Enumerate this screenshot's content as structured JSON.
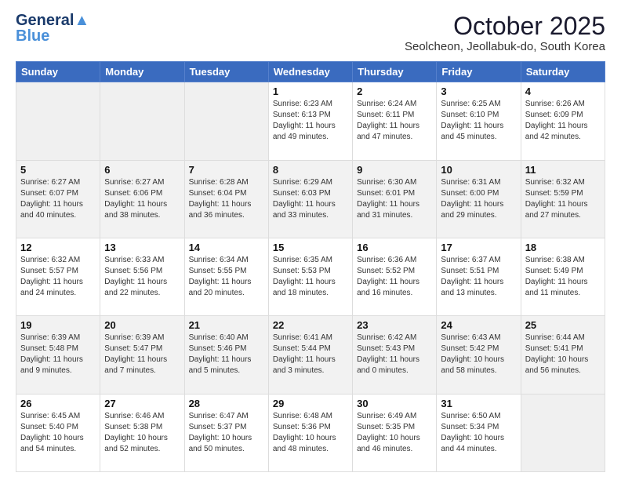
{
  "header": {
    "logo_line1": "General",
    "logo_line2": "Blue",
    "title": "October 2025",
    "subtitle": "Seolcheon, Jeollabuk-do, South Korea"
  },
  "weekdays": [
    "Sunday",
    "Monday",
    "Tuesday",
    "Wednesday",
    "Thursday",
    "Friday",
    "Saturday"
  ],
  "weeks": [
    [
      {
        "day": "",
        "info": ""
      },
      {
        "day": "",
        "info": ""
      },
      {
        "day": "",
        "info": ""
      },
      {
        "day": "1",
        "info": "Sunrise: 6:23 AM\nSunset: 6:13 PM\nDaylight: 11 hours\nand 49 minutes."
      },
      {
        "day": "2",
        "info": "Sunrise: 6:24 AM\nSunset: 6:11 PM\nDaylight: 11 hours\nand 47 minutes."
      },
      {
        "day": "3",
        "info": "Sunrise: 6:25 AM\nSunset: 6:10 PM\nDaylight: 11 hours\nand 45 minutes."
      },
      {
        "day": "4",
        "info": "Sunrise: 6:26 AM\nSunset: 6:09 PM\nDaylight: 11 hours\nand 42 minutes."
      }
    ],
    [
      {
        "day": "5",
        "info": "Sunrise: 6:27 AM\nSunset: 6:07 PM\nDaylight: 11 hours\nand 40 minutes."
      },
      {
        "day": "6",
        "info": "Sunrise: 6:27 AM\nSunset: 6:06 PM\nDaylight: 11 hours\nand 38 minutes."
      },
      {
        "day": "7",
        "info": "Sunrise: 6:28 AM\nSunset: 6:04 PM\nDaylight: 11 hours\nand 36 minutes."
      },
      {
        "day": "8",
        "info": "Sunrise: 6:29 AM\nSunset: 6:03 PM\nDaylight: 11 hours\nand 33 minutes."
      },
      {
        "day": "9",
        "info": "Sunrise: 6:30 AM\nSunset: 6:01 PM\nDaylight: 11 hours\nand 31 minutes."
      },
      {
        "day": "10",
        "info": "Sunrise: 6:31 AM\nSunset: 6:00 PM\nDaylight: 11 hours\nand 29 minutes."
      },
      {
        "day": "11",
        "info": "Sunrise: 6:32 AM\nSunset: 5:59 PM\nDaylight: 11 hours\nand 27 minutes."
      }
    ],
    [
      {
        "day": "12",
        "info": "Sunrise: 6:32 AM\nSunset: 5:57 PM\nDaylight: 11 hours\nand 24 minutes."
      },
      {
        "day": "13",
        "info": "Sunrise: 6:33 AM\nSunset: 5:56 PM\nDaylight: 11 hours\nand 22 minutes."
      },
      {
        "day": "14",
        "info": "Sunrise: 6:34 AM\nSunset: 5:55 PM\nDaylight: 11 hours\nand 20 minutes."
      },
      {
        "day": "15",
        "info": "Sunrise: 6:35 AM\nSunset: 5:53 PM\nDaylight: 11 hours\nand 18 minutes."
      },
      {
        "day": "16",
        "info": "Sunrise: 6:36 AM\nSunset: 5:52 PM\nDaylight: 11 hours\nand 16 minutes."
      },
      {
        "day": "17",
        "info": "Sunrise: 6:37 AM\nSunset: 5:51 PM\nDaylight: 11 hours\nand 13 minutes."
      },
      {
        "day": "18",
        "info": "Sunrise: 6:38 AM\nSunset: 5:49 PM\nDaylight: 11 hours\nand 11 minutes."
      }
    ],
    [
      {
        "day": "19",
        "info": "Sunrise: 6:39 AM\nSunset: 5:48 PM\nDaylight: 11 hours\nand 9 minutes."
      },
      {
        "day": "20",
        "info": "Sunrise: 6:39 AM\nSunset: 5:47 PM\nDaylight: 11 hours\nand 7 minutes."
      },
      {
        "day": "21",
        "info": "Sunrise: 6:40 AM\nSunset: 5:46 PM\nDaylight: 11 hours\nand 5 minutes."
      },
      {
        "day": "22",
        "info": "Sunrise: 6:41 AM\nSunset: 5:44 PM\nDaylight: 11 hours\nand 3 minutes."
      },
      {
        "day": "23",
        "info": "Sunrise: 6:42 AM\nSunset: 5:43 PM\nDaylight: 11 hours\nand 0 minutes."
      },
      {
        "day": "24",
        "info": "Sunrise: 6:43 AM\nSunset: 5:42 PM\nDaylight: 10 hours\nand 58 minutes."
      },
      {
        "day": "25",
        "info": "Sunrise: 6:44 AM\nSunset: 5:41 PM\nDaylight: 10 hours\nand 56 minutes."
      }
    ],
    [
      {
        "day": "26",
        "info": "Sunrise: 6:45 AM\nSunset: 5:40 PM\nDaylight: 10 hours\nand 54 minutes."
      },
      {
        "day": "27",
        "info": "Sunrise: 6:46 AM\nSunset: 5:38 PM\nDaylight: 10 hours\nand 52 minutes."
      },
      {
        "day": "28",
        "info": "Sunrise: 6:47 AM\nSunset: 5:37 PM\nDaylight: 10 hours\nand 50 minutes."
      },
      {
        "day": "29",
        "info": "Sunrise: 6:48 AM\nSunset: 5:36 PM\nDaylight: 10 hours\nand 48 minutes."
      },
      {
        "day": "30",
        "info": "Sunrise: 6:49 AM\nSunset: 5:35 PM\nDaylight: 10 hours\nand 46 minutes."
      },
      {
        "day": "31",
        "info": "Sunrise: 6:50 AM\nSunset: 5:34 PM\nDaylight: 10 hours\nand 44 minutes."
      },
      {
        "day": "",
        "info": ""
      }
    ]
  ]
}
